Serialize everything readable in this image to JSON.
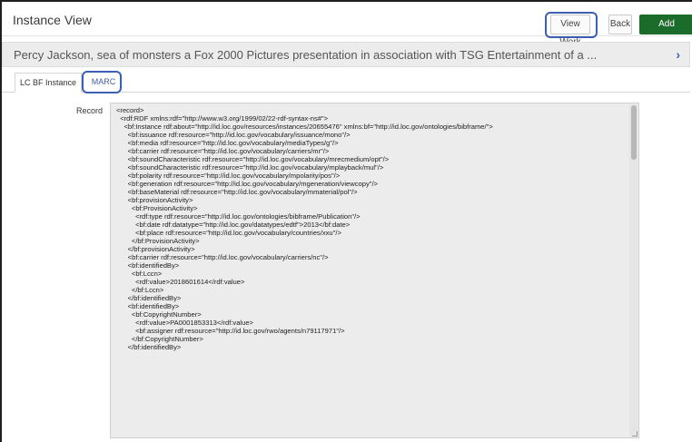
{
  "header": {
    "title": "Instance View",
    "view_work_label": "View Work",
    "back_label": "Back",
    "add_holdings_label": "Add Holdings"
  },
  "banner": {
    "title": "Percy Jackson, sea of monsters a Fox 2000 Pictures presentation in association with TSG Entertainment of a ...",
    "chevron": "›"
  },
  "tabs": {
    "lc_bf_instance": "LC BF Instance",
    "marc": "MARC"
  },
  "record": {
    "label": "Record",
    "lines": [
      "<record>",
      "  <rdf:RDF xmlns:rdf=\"http://www.w3.org/1999/02/22-rdf-syntax-ns#\">",
      "    <bf:Instance rdf:about=\"http://id.loc.gov/resources/instances/20655476\" xmlns:bf=\"http://id.loc.gov/ontologies/bibframe/\">",
      "      <bf:issuance rdf:resource=\"http://id.loc.gov/vocabulary/issuance/mono\"/>",
      "      <bf:media rdf:resource=\"http://id.loc.gov/vocabulary/mediaTypes/g\"/>",
      "      <bf:carrier rdf:resource=\"http://id.loc.gov/vocabulary/carriers/mr\"/>",
      "      <bf:soundCharacteristic rdf:resource=\"http://id.loc.gov/vocabulary/mrecmedium/opt\"/>",
      "      <bf:soundCharacteristic rdf:resource=\"http://id.loc.gov/vocabulary/mplayback/mul\"/>",
      "      <bf:polarity rdf:resource=\"http://id.loc.gov/vocabulary/mpolarity/pos\"/>",
      "      <bf:generation rdf:resource=\"http://id.loc.gov/vocabulary/mgeneration/viewcopy\"/>",
      "      <bf:baseMaterial rdf:resource=\"http://id.loc.gov/vocabulary/mmaterial/pol\"/>",
      "      <bf:provisionActivity>",
      "        <bf:ProvisionActivity>",
      "          <rdf:type rdf:resource=\"http://id.loc.gov/ontologies/bibframe/Publication\"/>",
      "          <bf:date rdf:datatype=\"http://id.loc.gov/datatypes/edtf\">2013</bf:date>",
      "          <bf:place rdf:resource=\"http://id.loc.gov/vocabulary/countries/xxu\"/>",
      "        </bf:ProvisionActivity>",
      "      </bf:provisionActivity>",
      "      <bf:carrier rdf:resource=\"http://id.loc.gov/vocabulary/carriers/nc\"/>",
      "      <bf:identifiedBy>",
      "        <bf:Lccn>",
      "          <rdf:value>2018601614</rdf:value>",
      "        </bf:Lccn>",
      "      </bf:identifiedBy>",
      "      <bf:identifiedBy>",
      "        <bf:CopyrightNumber>",
      "          <rdf:value>PA0001853313</rdf:value>",
      "          <bf:assigner rdf:resource=\"http://id.loc.gov/rwo/agents/n79117971\"/>",
      "        </bf:CopyrightNumber>",
      "      </bf:identifiedBy>"
    ]
  }
}
